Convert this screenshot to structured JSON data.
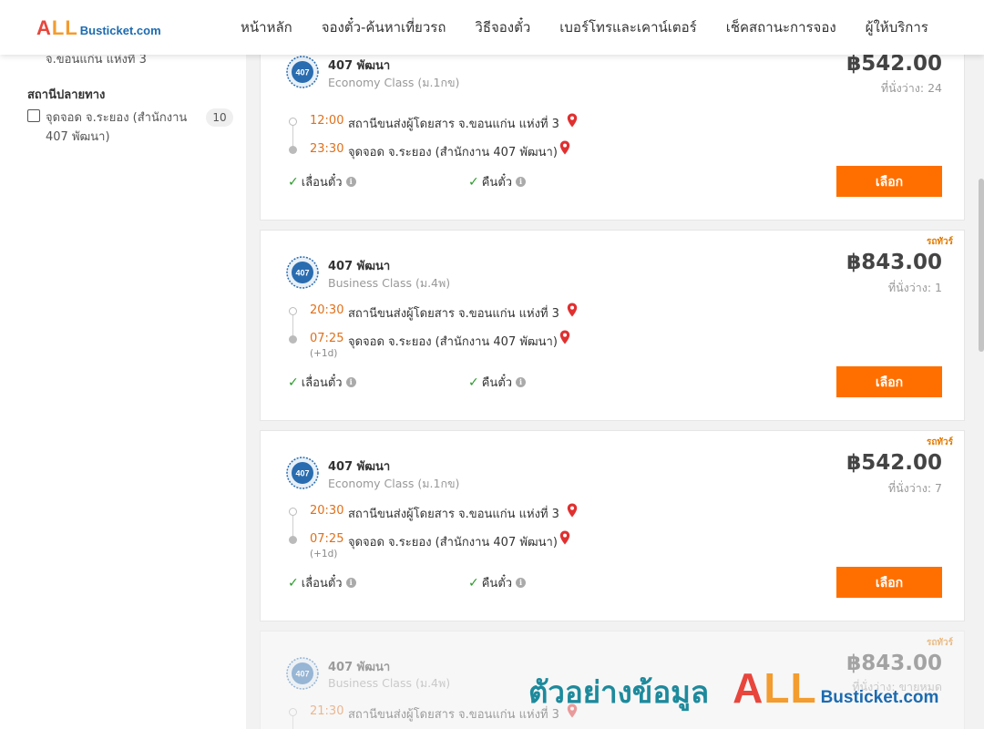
{
  "header": {
    "logo": {
      "all_a": "A",
      "all_ll": "LL",
      "rest": "Busticket.com"
    },
    "nav": [
      "หน้าหลัก",
      "จองตั๋ว-ค้นหาเที่ยวรถ",
      "วิธีจองตั๋ว",
      "เบอร์โทรและเคาน์เตอร์",
      "เช็คสถานะการจอง",
      "ผู้ให้บริการ"
    ]
  },
  "sidebar": {
    "cut_text": "จ.ขอนแก่น แห่งที่ 3",
    "heading": "สถานีปลายทาง",
    "option_label": "จุดจอด จ.ระยอง (สำนักงาน 407 พัฒนา)",
    "option_count": "10"
  },
  "trips": [
    {
      "badge": "",
      "operator": "407 พัฒนา",
      "class": "Economy Class (ม.1กข)",
      "price": "฿542.00",
      "seats": "ที่นั่งว่าง: 24",
      "dep_time": "12:00",
      "dep_station": "สถานีขนส่งผู้โดยสาร จ.ขอนแก่น แห่งที่ 3",
      "arr_time": "23:30",
      "arr_station": "จุดจอด จ.ระยอง (สำนักงาน 407 พัฒนา)",
      "next_day": "",
      "feature_change": "เลื่อนตั๋ว",
      "feature_refund": "คืนตั๋ว",
      "button": "เลือก"
    },
    {
      "badge": "รถทัวร์",
      "operator": "407 พัฒนา",
      "class": "Business Class (ม.4พ)",
      "price": "฿843.00",
      "seats": "ที่นั่งว่าง: 1",
      "dep_time": "20:30",
      "dep_station": "สถานีขนส่งผู้โดยสาร จ.ขอนแก่น แห่งที่ 3",
      "arr_time": "07:25",
      "arr_station": "จุดจอด จ.ระยอง (สำนักงาน 407 พัฒนา)",
      "next_day": "(+1d)",
      "feature_change": "เลื่อนตั๋ว",
      "feature_refund": "คืนตั๋ว",
      "button": "เลือก"
    },
    {
      "badge": "รถทัวร์",
      "operator": "407 พัฒนา",
      "class": "Economy Class (ม.1กข)",
      "price": "฿542.00",
      "seats": "ที่นั่งว่าง: 7",
      "dep_time": "20:30",
      "dep_station": "สถานีขนส่งผู้โดยสาร จ.ขอนแก่น แห่งที่ 3",
      "arr_time": "07:25",
      "arr_station": "จุดจอด จ.ระยอง (สำนักงาน 407 พัฒนา)",
      "next_day": "(+1d)",
      "feature_change": "เลื่อนตั๋ว",
      "feature_refund": "คืนตั๋ว",
      "button": "เลือก"
    },
    {
      "badge": "รถทัวร์",
      "operator": "407 พัฒนา",
      "class": "Business Class (ม.4พ)",
      "price": "฿843.00",
      "seats": "ที่นั่งว่าง: ขายหมด",
      "dep_time": "21:30",
      "dep_station": "สถานีขนส่งผู้โดยสาร จ.ขอนแก่น แห่งที่ 3"
    }
  ],
  "operator_logo_text": "407",
  "watermark": {
    "text": "ตัวอย่างข้อมูล",
    "all_a": "A",
    "all_ll": "LL",
    "rest": "Busticket.com"
  },
  "colors": {
    "accent": "#ff6f00",
    "time": "#e0701a",
    "check": "#2c9a2c",
    "pin": "#e03030",
    "logo_blue": "#1c6bb0"
  },
  "icons": {
    "pin": "map-pin-icon",
    "check": "check-icon",
    "info": "info-icon",
    "operator": "bus-operator-logo"
  }
}
